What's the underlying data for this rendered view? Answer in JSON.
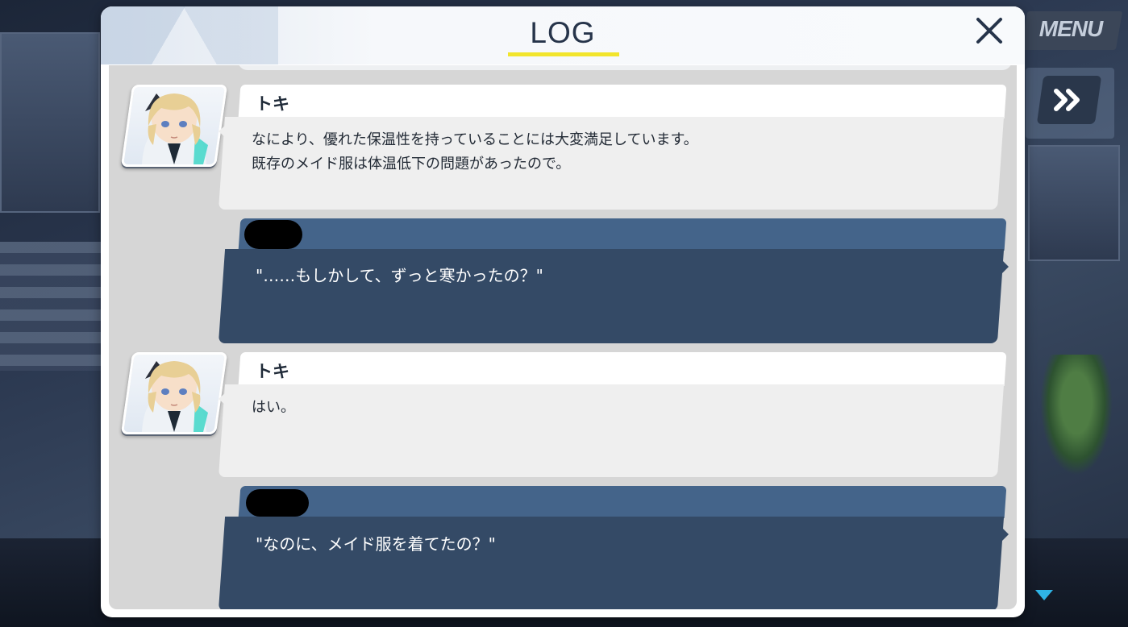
{
  "header": {
    "title": "LOG",
    "menu_label": "MENU"
  },
  "icons": {
    "close": "close-icon",
    "fast_forward": "fast-forward-icon",
    "scroll_down": "scroll-down-arrow-icon"
  },
  "colors": {
    "accent_underline": "#f2e52c",
    "player_bubble": "#344a66",
    "player_name_bar": "#44648a",
    "npc_bubble": "#efefef",
    "scroll_arrow": "#2fb4e6"
  },
  "entries": [
    {
      "speaker": "トキ",
      "lines": "なにより、優れた保温性を持っていることには大変満足しています。\n既存のメイド服は体温低下の問題があったので。"
    },
    {
      "speaker": "",
      "text": "\"……もしかして、ずっと寒かったの？\""
    },
    {
      "speaker": "トキ",
      "lines": "はい。"
    },
    {
      "speaker": "",
      "text": "\"なのに、メイド服を着てたの？\""
    }
  ]
}
